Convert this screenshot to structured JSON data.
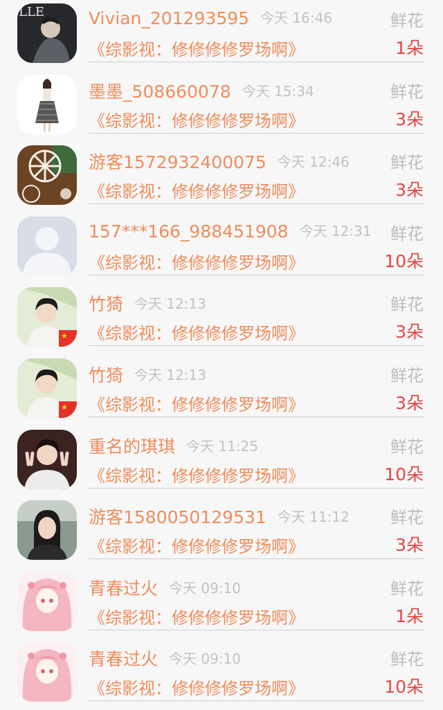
{
  "gift_list": [
    {
      "name": "Vivian_201293595",
      "time": "今天 16:46",
      "gift_type": "鲜花",
      "message": "《综影视：修修修修罗场啊》",
      "count": "1朵",
      "avatar": "magazine-cover-avatar"
    },
    {
      "name": "墨墨_508660078",
      "time": "今天 15:34",
      "gift_type": "鲜花",
      "message": "《综影视：修修修修罗场啊》",
      "count": "3朵",
      "avatar": "fashion-girl-avatar"
    },
    {
      "name": "游客1572932400075",
      "time": "今天 12:46",
      "gift_type": "鲜花",
      "message": "《综影视：修修修修罗场啊》",
      "count": "3朵",
      "avatar": "snowflake-avatar"
    },
    {
      "name": "157***166_988451908",
      "time": "今天 12:31",
      "gift_type": "鲜花",
      "message": "《综影视：修修修修罗场啊》",
      "count": "10朵",
      "avatar": "default-user-avatar"
    },
    {
      "name": "竹猗",
      "time": "今天 12:13",
      "gift_type": "鲜花",
      "message": "《综影视：修修修修罗场啊》",
      "count": "3朵",
      "avatar": "young-man-flag-avatar"
    },
    {
      "name": "竹猗",
      "time": "今天 12:13",
      "gift_type": "鲜花",
      "message": "《综影视：修修修修罗场啊》",
      "count": "3朵",
      "avatar": "young-man-flag-avatar"
    },
    {
      "name": "重名的琪琪",
      "time": "今天 11:25",
      "gift_type": "鲜花",
      "message": "《综影视：修修修修罗场啊》",
      "count": "10朵",
      "avatar": "peace-sign-man-avatar"
    },
    {
      "name": "游客1580050129531",
      "time": "今天 11:12",
      "gift_type": "鲜花",
      "message": "《综影视：修修修修罗场啊》",
      "count": "3朵",
      "avatar": "woman-portrait-avatar"
    },
    {
      "name": "青春过火",
      "time": "今天 09:10",
      "gift_type": "鲜花",
      "message": "《综影视：修修修修罗场啊》",
      "count": "1朵",
      "avatar": "anime-pink-girl-avatar"
    },
    {
      "name": "青春过火",
      "time": "今天 09:10",
      "gift_type": "鲜花",
      "message": "《综影视：修修修修罗场啊》",
      "count": "10朵",
      "avatar": "anime-pink-girl-avatar"
    }
  ],
  "colors": {
    "name": "#ef8d5c",
    "time": "#c2c2c2",
    "gift_type": "#bdbdbd",
    "count": "#e64545",
    "background": "#f7f7f7"
  }
}
